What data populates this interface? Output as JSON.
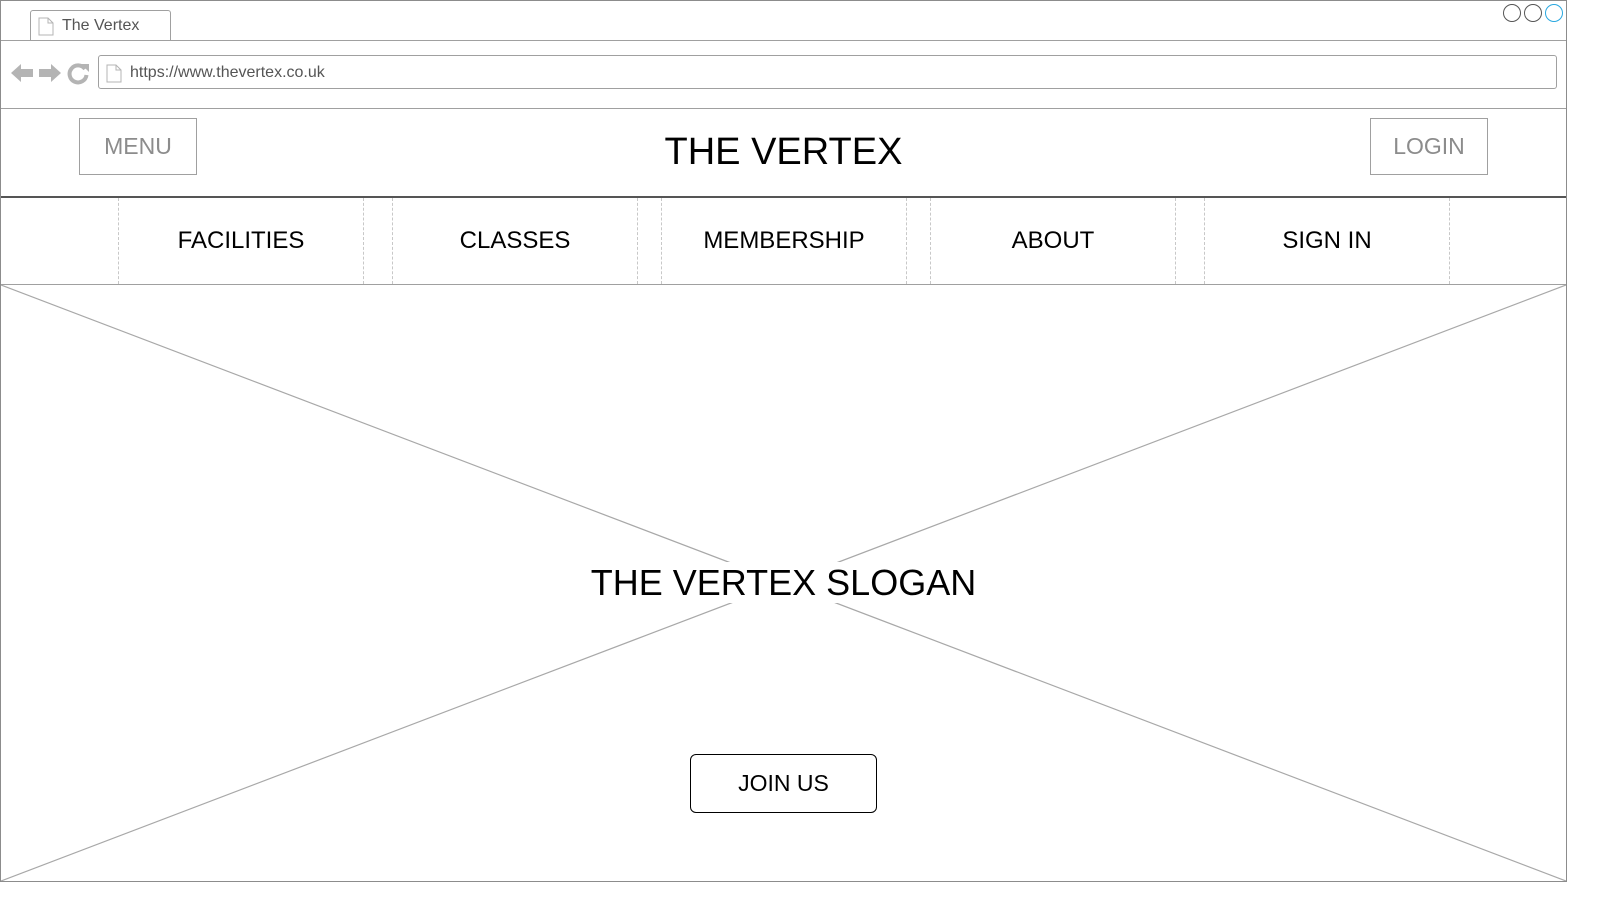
{
  "browser": {
    "tab_title": "The Vertex",
    "url": "https://www.thevertex.co.uk",
    "icons": {
      "tab": "page-icon",
      "back": "arrow-left-icon",
      "forward": "arrow-right-icon",
      "reload": "reload-icon",
      "url": "page-icon"
    },
    "window_control_accent": "#29a8e0"
  },
  "header": {
    "menu_label": "MENU",
    "title": "THE VERTEX",
    "login_label": "LOGIN"
  },
  "nav": {
    "items": [
      {
        "label": "FACILITIES"
      },
      {
        "label": "CLASSES"
      },
      {
        "label": "MEMBERSHIP"
      },
      {
        "label": "ABOUT"
      },
      {
        "label": "SIGN IN"
      }
    ]
  },
  "hero": {
    "slogan": "THE VERTEX SLOGAN",
    "cta_label": "JOIN US",
    "image_placeholder_icon": "image-placeholder-icon"
  }
}
